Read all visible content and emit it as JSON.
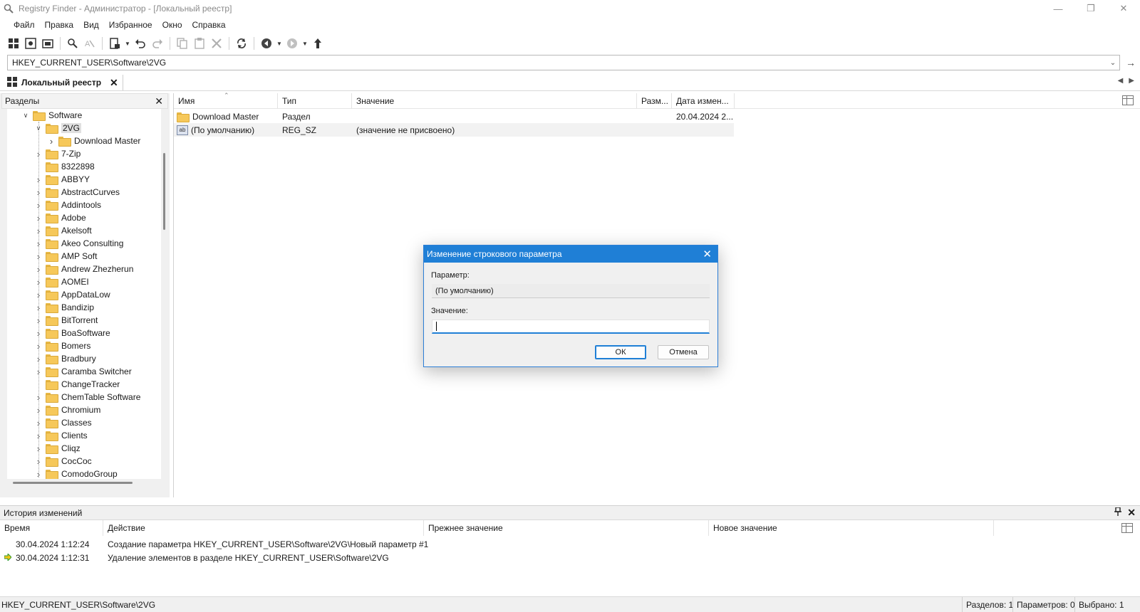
{
  "window": {
    "title": "Registry Finder - Администратор - [Локальный реестр]",
    "controls": [
      "minimize",
      "restore",
      "close"
    ]
  },
  "menu": [
    "Файл",
    "Правка",
    "Вид",
    "Избранное",
    "Окно",
    "Справка"
  ],
  "address": {
    "path": "HKEY_CURRENT_USER\\Software\\2VG"
  },
  "tab": {
    "label": "Локальный реестр"
  },
  "tree": {
    "header": "Разделы",
    "items": [
      {
        "label": "Software",
        "level": 0,
        "expanded": true
      },
      {
        "label": "2VG",
        "level": 1,
        "expanded": true,
        "selected": true
      },
      {
        "label": "Download Master",
        "level": 2
      },
      {
        "label": "7-Zip",
        "level": 1
      },
      {
        "label": "8322898",
        "level": 1
      },
      {
        "label": "ABBYY",
        "level": 1
      },
      {
        "label": "AbstractCurves",
        "level": 1
      },
      {
        "label": "Addintools",
        "level": 1
      },
      {
        "label": "Adobe",
        "level": 1
      },
      {
        "label": "Akelsoft",
        "level": 1
      },
      {
        "label": "Akeo Consulting",
        "level": 1
      },
      {
        "label": "AMP Soft",
        "level": 1
      },
      {
        "label": "Andrew Zhezherun",
        "level": 1
      },
      {
        "label": "AOMEI",
        "level": 1
      },
      {
        "label": "AppDataLow",
        "level": 1
      },
      {
        "label": "Bandizip",
        "level": 1
      },
      {
        "label": "BitTorrent",
        "level": 1
      },
      {
        "label": "BoaSoftware",
        "level": 1
      },
      {
        "label": "Bomers",
        "level": 1
      },
      {
        "label": "Bradbury",
        "level": 1
      },
      {
        "label": "Caramba Switcher",
        "level": 1
      },
      {
        "label": "ChangeTracker",
        "level": 1
      },
      {
        "label": "ChemTable Software",
        "level": 1
      },
      {
        "label": "Chromium",
        "level": 1
      },
      {
        "label": "Classes",
        "level": 1
      },
      {
        "label": "Clients",
        "level": 1
      },
      {
        "label": "Cliqz",
        "level": 1
      },
      {
        "label": "CocCoc",
        "level": 1
      },
      {
        "label": "ComodoGroup",
        "level": 1
      }
    ]
  },
  "list": {
    "columns": [
      "Имя",
      "Тип",
      "Значение",
      "Разм...",
      "Дата измен..."
    ],
    "rows": [
      {
        "icon": "folder-icon",
        "name": "Download Master",
        "type": "Раздел",
        "value": "",
        "size": "",
        "date": "20.04.2024 2..."
      },
      {
        "icon": "string-value-icon",
        "name": "(По умолчанию)",
        "type": "REG_SZ",
        "value": "(значение не присвоено)",
        "size": "",
        "date": ""
      }
    ]
  },
  "dialog": {
    "title": "Изменение строкового параметра",
    "param_label": "Параметр:",
    "param_value": "(По умолчанию)",
    "value_label": "Значение:",
    "value": "",
    "ok": "ОК",
    "cancel": "Отмена"
  },
  "history": {
    "title": "История изменений",
    "columns": [
      "Время",
      "Действие",
      "Прежнее значение",
      "Новое значение"
    ],
    "rows": [
      {
        "time": "30.04.2024 1:12:24",
        "action": "Создание параметра HKEY_CURRENT_USER\\Software\\2VG\\Новый параметр #1",
        "old": "",
        "new": "",
        "current": false
      },
      {
        "time": "30.04.2024 1:12:31",
        "action": "Удаление элементов в разделе HKEY_CURRENT_USER\\Software\\2VG",
        "old": "",
        "new": "",
        "current": true
      }
    ]
  },
  "status": {
    "path": "HKEY_CURRENT_USER\\Software\\2VG",
    "sections": "Разделов: 1",
    "params": "Параметров: 0",
    "selected": "Выбрано: 1"
  }
}
